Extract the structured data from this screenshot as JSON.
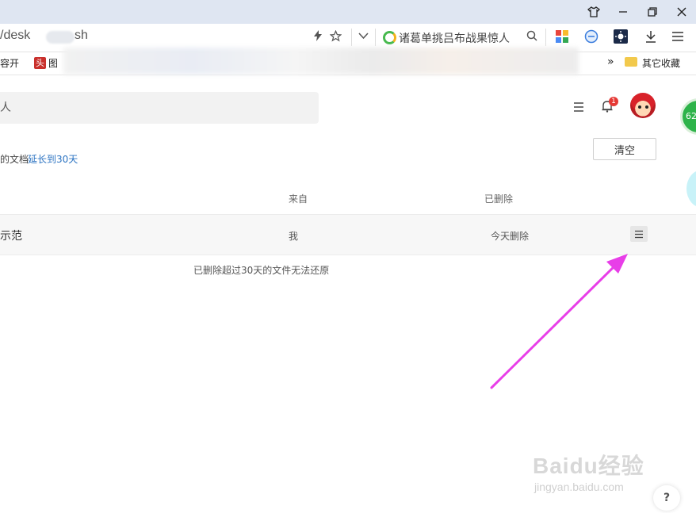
{
  "browser": {
    "url_prefix": "/desk",
    "url_suffix": "sh",
    "search_suggestion": "诸葛单挑吕布战果惊人",
    "bookmarks": {
      "first_label": "容开",
      "second_badge": "头",
      "second_label": "图",
      "other_bookmarks_chevron": "»",
      "other_bookmarks_label": "其它收藏"
    }
  },
  "page": {
    "search_fragment": "人",
    "notification_count": "1",
    "floating_badge": "62",
    "notice_prefix": "的文档",
    "extend_link": "延长到30天",
    "clear_button": "清空",
    "columns": {
      "from": "来自",
      "deleted": "已删除"
    },
    "rows": [
      {
        "name": "示范",
        "from": "我",
        "deleted": "今天删除"
      }
    ],
    "footer_note": "已删除超过30天的文件无法还原",
    "help": "?"
  },
  "watermark": {
    "main": "Baidu经验",
    "sub": "jingyan.baidu.com"
  },
  "colors": {
    "link": "#2b73c2",
    "arrow": "#e83ee8",
    "badge": "#e53935",
    "float_green": "#2eb34a"
  }
}
